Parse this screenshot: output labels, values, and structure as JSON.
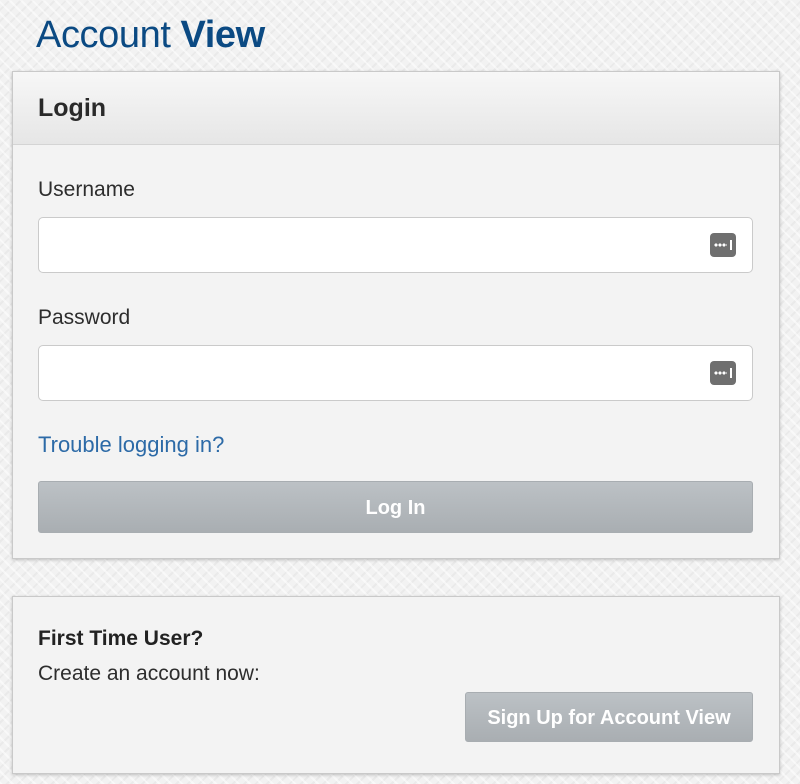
{
  "brand": {
    "light": "Account",
    "bold": "View",
    "color": "#0b4a83"
  },
  "login_panel": {
    "title": "Login",
    "username_label": "Username",
    "username_value": "",
    "username_placeholder": "",
    "password_label": "Password",
    "password_value": "",
    "password_placeholder": "",
    "trouble_link": "Trouble logging in?",
    "login_button": "Log In"
  },
  "first_time_panel": {
    "title": "First Time User?",
    "subtitle": "Create an account now:",
    "signup_button": "Sign Up for Account View"
  },
  "icons": {
    "username_field_icon": "password-key-icon",
    "password_field_icon": "password-key-icon"
  },
  "colors": {
    "link": "#2c6aa7",
    "button_bg": "#b2b7bb",
    "button_text": "#ffffff"
  }
}
